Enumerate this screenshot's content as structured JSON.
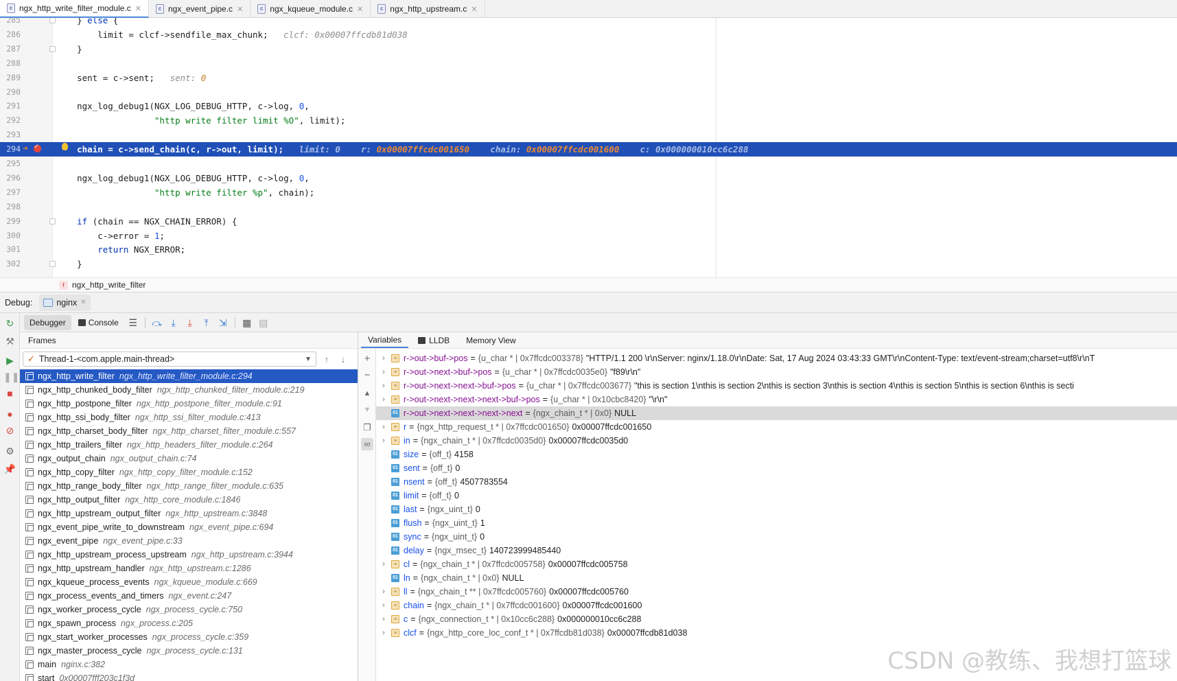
{
  "tabs": [
    {
      "label": "ngx_http_write_filter_module.c",
      "active": true
    },
    {
      "label": "ngx_event_pipe.c",
      "active": false
    },
    {
      "label": "ngx_kqueue_module.c",
      "active": false
    },
    {
      "label": "ngx_http_upstream.c",
      "active": false
    }
  ],
  "editor": {
    "lines": [
      {
        "n": "285",
        "html": "    } <span class='kw'>else</span> {",
        "fold": true
      },
      {
        "n": "286",
        "html": "        limit = clcf->sendfile_max_chunk;   <span class='hint'>clcf: 0x00007ffcdb81d038</span>"
      },
      {
        "n": "287",
        "html": "    }",
        "fold": true
      },
      {
        "n": "288",
        "html": ""
      },
      {
        "n": "289",
        "html": "    sent = c->sent;   <span class='hint'>sent: </span><span class='hint-num'>0</span>"
      },
      {
        "n": "290",
        "html": ""
      },
      {
        "n": "291",
        "html": "    ngx_log_debug1(NGX_LOG_DEBUG_HTTP, c->log, <span class='num-lit'>0</span>,"
      },
      {
        "n": "292",
        "html": "                   <span class='str'>\"http write filter limit %O\"</span>, limit);"
      },
      {
        "n": "293",
        "html": ""
      },
      {
        "n": "294",
        "html": "    chain = c->send_chain(c, r->out, limit);   <span class='hint'>limit: 0</span>    <span class='hint'>r: </span><span class='hint-val'>0x00007ffcdc001650</span>    <span class='hint'>chain: </span><span class='hint-val'>0x00007ffcdc001600</span>    <span class='hint'>c: 0x000000010cc6c288</span>",
        "current": true
      },
      {
        "n": "295",
        "html": ""
      },
      {
        "n": "296",
        "html": "    ngx_log_debug1(NGX_LOG_DEBUG_HTTP, c->log, <span class='num-lit'>0</span>,"
      },
      {
        "n": "297",
        "html": "                   <span class='str'>\"http write filter %p\"</span>, chain);"
      },
      {
        "n": "298",
        "html": ""
      },
      {
        "n": "299",
        "html": "    <span class='kw'>if</span> (chain == NGX_CHAIN_ERROR) {",
        "fold": true
      },
      {
        "n": "300",
        "html": "        c->error = <span class='num-lit'>1</span>;"
      },
      {
        "n": "301",
        "html": "        <span class='kw'>return</span> NGX_ERROR;"
      },
      {
        "n": "302",
        "html": "    }",
        "fold": true
      }
    ]
  },
  "breadcrumb": {
    "function": "ngx_http_write_filter"
  },
  "debug": {
    "label": "Debug:",
    "run_config": "nginx"
  },
  "toolbar": {
    "debugger_tab": "Debugger",
    "console_tab": "Console"
  },
  "frames": {
    "title": "Frames",
    "thread": "Thread-1-<com.apple.main-thread>",
    "items": [
      {
        "fn": "ngx_http_write_filter",
        "loc": "ngx_http_write_filter_module.c:294",
        "selected": true
      },
      {
        "fn": "ngx_http_chunked_body_filter",
        "loc": "ngx_http_chunked_filter_module.c:219"
      },
      {
        "fn": "ngx_http_postpone_filter",
        "loc": "ngx_http_postpone_filter_module.c:91"
      },
      {
        "fn": "ngx_http_ssi_body_filter",
        "loc": "ngx_http_ssi_filter_module.c:413"
      },
      {
        "fn": "ngx_http_charset_body_filter",
        "loc": "ngx_http_charset_filter_module.c:557"
      },
      {
        "fn": "ngx_http_trailers_filter",
        "loc": "ngx_http_headers_filter_module.c:264"
      },
      {
        "fn": "ngx_output_chain",
        "loc": "ngx_output_chain.c:74"
      },
      {
        "fn": "ngx_http_copy_filter",
        "loc": "ngx_http_copy_filter_module.c:152"
      },
      {
        "fn": "ngx_http_range_body_filter",
        "loc": "ngx_http_range_filter_module.c:635"
      },
      {
        "fn": "ngx_http_output_filter",
        "loc": "ngx_http_core_module.c:1846"
      },
      {
        "fn": "ngx_http_upstream_output_filter",
        "loc": "ngx_http_upstream.c:3848"
      },
      {
        "fn": "ngx_event_pipe_write_to_downstream",
        "loc": "ngx_event_pipe.c:694"
      },
      {
        "fn": "ngx_event_pipe",
        "loc": "ngx_event_pipe.c:33"
      },
      {
        "fn": "ngx_http_upstream_process_upstream",
        "loc": "ngx_http_upstream.c:3944"
      },
      {
        "fn": "ngx_http_upstream_handler",
        "loc": "ngx_http_upstream.c:1286"
      },
      {
        "fn": "ngx_kqueue_process_events",
        "loc": "ngx_kqueue_module.c:669"
      },
      {
        "fn": "ngx_process_events_and_timers",
        "loc": "ngx_event.c:247"
      },
      {
        "fn": "ngx_worker_process_cycle",
        "loc": "ngx_process_cycle.c:750"
      },
      {
        "fn": "ngx_spawn_process",
        "loc": "ngx_process.c:205"
      },
      {
        "fn": "ngx_start_worker_processes",
        "loc": "ngx_process_cycle.c:359"
      },
      {
        "fn": "ngx_master_process_cycle",
        "loc": "ngx_process_cycle.c:131"
      },
      {
        "fn": "main",
        "loc": "nginx.c:382"
      },
      {
        "fn": "start",
        "loc": "0x00007fff203c1f3d"
      }
    ]
  },
  "variables": {
    "tabs": [
      "Variables",
      "LLDB",
      "Memory View"
    ],
    "items": [
      {
        "expand": true,
        "kind": "struct",
        "watch": true,
        "name": "r->out->buf->pos",
        "type": "{u_char * | 0x7ffcdc003378}",
        "value": "\"HTTP/1.1 200 \\r\\nServer: nginx/1.18.0\\r\\nDate: Sat, 17 Aug 2024 03:43:33 GMT\\r\\nContent-Type: text/event-stream;charset=utf8\\r\\nT"
      },
      {
        "expand": true,
        "kind": "struct",
        "watch": true,
        "name": "r->out->next->buf->pos",
        "type": "{u_char * | 0x7ffcdc0035e0}",
        "value": "\"f89\\r\\n\""
      },
      {
        "expand": true,
        "kind": "struct",
        "watch": true,
        "name": "r->out->next->next->buf->pos",
        "type": "{u_char * | 0x7ffcdc003677}",
        "value": "\"this is section 1\\nthis is section 2\\nthis is section 3\\nthis is section 4\\nthis is section 5\\nthis is section 6\\nthis is secti"
      },
      {
        "expand": true,
        "kind": "struct",
        "watch": true,
        "name": "r->out->next->next->next->buf->pos",
        "type": "{u_char * | 0x10cbc8420}",
        "value": "\"\\r\\n\""
      },
      {
        "expand": false,
        "kind": "prim",
        "watch": true,
        "name": "r->out->next->next->next->next",
        "type": "{ngx_chain_t * | 0x0}",
        "value": "NULL",
        "selected": true
      },
      {
        "expand": true,
        "kind": "struct",
        "name": "r",
        "type": "{ngx_http_request_t * | 0x7ffcdc001650}",
        "value": "0x00007ffcdc001650"
      },
      {
        "expand": true,
        "kind": "struct",
        "name": "in",
        "type": "{ngx_chain_t * | 0x7ffcdc0035d0}",
        "value": "0x00007ffcdc0035d0"
      },
      {
        "expand": false,
        "kind": "prim",
        "name": "size",
        "type": "{off_t}",
        "value": "4158"
      },
      {
        "expand": false,
        "kind": "prim",
        "name": "sent",
        "type": "{off_t}",
        "value": "0"
      },
      {
        "expand": false,
        "kind": "prim",
        "name": "nsent",
        "type": "{off_t}",
        "value": "4507783554"
      },
      {
        "expand": false,
        "kind": "prim",
        "name": "limit",
        "type": "{off_t}",
        "value": "0"
      },
      {
        "expand": false,
        "kind": "prim",
        "name": "last",
        "type": "{ngx_uint_t}",
        "value": "0"
      },
      {
        "expand": false,
        "kind": "prim",
        "name": "flush",
        "type": "{ngx_uint_t}",
        "value": "1"
      },
      {
        "expand": false,
        "kind": "prim",
        "name": "sync",
        "type": "{ngx_uint_t}",
        "value": "0"
      },
      {
        "expand": false,
        "kind": "prim",
        "name": "delay",
        "type": "{ngx_msec_t}",
        "value": "140723999485440"
      },
      {
        "expand": true,
        "kind": "struct",
        "name": "cl",
        "type": "{ngx_chain_t * | 0x7ffcdc005758}",
        "value": "0x00007ffcdc005758"
      },
      {
        "expand": false,
        "kind": "prim",
        "name": "ln",
        "type": "{ngx_chain_t * | 0x0}",
        "value": "NULL"
      },
      {
        "expand": true,
        "kind": "struct",
        "name": "ll",
        "type": "{ngx_chain_t ** | 0x7ffcdc005760}",
        "value": "0x00007ffcdc005760"
      },
      {
        "expand": true,
        "kind": "struct",
        "name": "chain",
        "type": "{ngx_chain_t * | 0x7ffcdc001600}",
        "value": "0x00007ffcdc001600"
      },
      {
        "expand": true,
        "kind": "struct",
        "name": "c",
        "type": "{ngx_connection_t * | 0x10cc6c288}",
        "value": "0x000000010cc6c288"
      },
      {
        "expand": true,
        "kind": "struct",
        "name": "clcf",
        "type": "{ngx_http_core_loc_conf_t * | 0x7ffcdb81d038}",
        "value": "0x00007ffcdb81d038"
      }
    ]
  },
  "watermark": "CSDN @教练、我想打篮球"
}
